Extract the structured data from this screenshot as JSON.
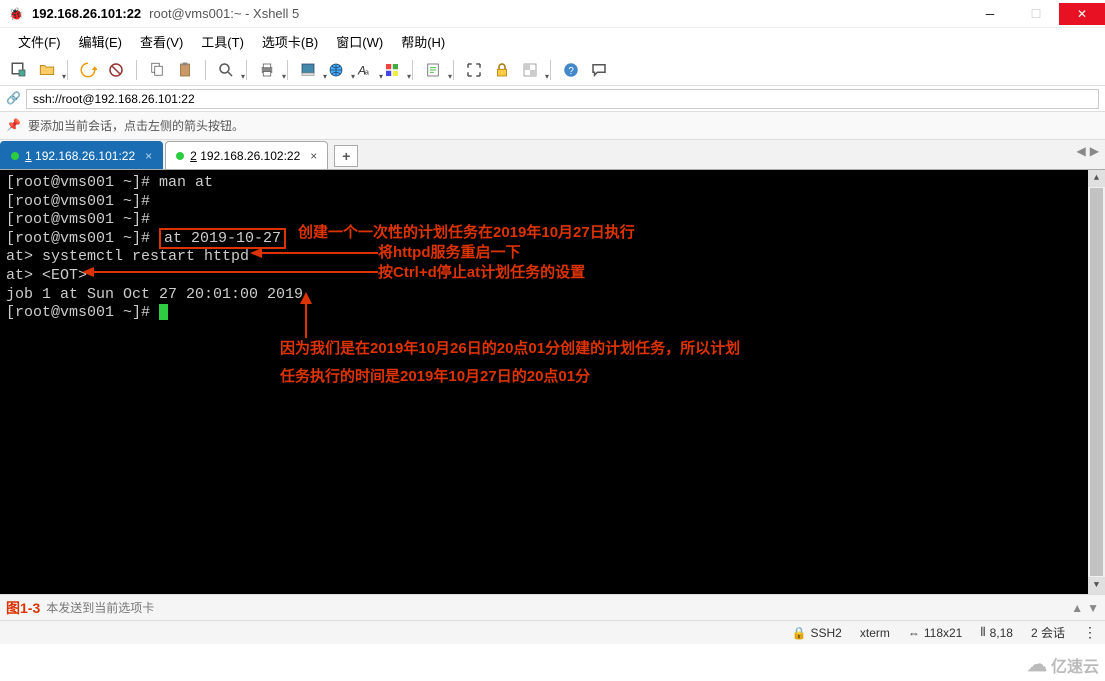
{
  "titlebar": {
    "host": "192.168.26.101:22",
    "subtitle": "root@vms001:~ - Xshell 5"
  },
  "menu": {
    "file": "文件(F)",
    "edit": "编辑(E)",
    "view": "查看(V)",
    "tools": "工具(T)",
    "tabs": "选项卡(B)",
    "window": "窗口(W)",
    "help": "帮助(H)"
  },
  "toolbar": {
    "new_session": "new-session",
    "open": "open",
    "reconnect": "reconnect",
    "disconnect": "disconnect",
    "copy": "copy",
    "paste": "paste",
    "find": "find",
    "print": "print",
    "properties": "properties",
    "globe": "globe",
    "font": "font",
    "color": "color",
    "run_script": "run-script",
    "fullscreen": "fullscreen",
    "lock": "lock",
    "transparent": "transparent",
    "help": "help",
    "feedback": "feedback"
  },
  "address": {
    "url": "ssh://root@192.168.26.101:22"
  },
  "hint": {
    "text": "要添加当前会话，点击左侧的箭头按钮。"
  },
  "tabs": {
    "items": [
      {
        "num": "1",
        "label": "192.168.26.101:22",
        "active": true
      },
      {
        "num": "2",
        "label": "192.168.26.102:22",
        "active": false
      }
    ]
  },
  "terminal": {
    "line1_prompt": "[root@vms001 ~]# ",
    "line1_cmd": "man at",
    "line2": "[root@vms001 ~]#",
    "line3": "[root@vms001 ~]#",
    "line4_prompt": "[root@vms001 ~]# ",
    "line4_boxed": "at 2019-10-27",
    "line5_prompt": "at> ",
    "line5_cmd": "systemctl restart httpd",
    "line6_prompt": "at> ",
    "line6_cmd": "<EOT>",
    "line7": "job 1 at Sun Oct 27 20:01:00 2019",
    "line8": "[root@vms001 ~]# "
  },
  "annotations": {
    "a1": "创建一个一次性的计划任务在2019年10月27日执行",
    "a2": "将httpd服务重启一下",
    "a3": "按Ctrl+d停止at计划任务的设置",
    "a4": "因为我们是在2019年10月26日的20点01分创建的计划任务，所以计划",
    "a5": "任务执行的时间是2019年10月27日的20点01分",
    "fig": "图1-3"
  },
  "sendbar": {
    "text": "本发送到当前选项卡"
  },
  "status": {
    "proto": "SSH2",
    "term": "xterm",
    "size": "118x21",
    "pos": "8,18",
    "sessions": "2 会话"
  },
  "watermark": {
    "text": "亿速云"
  }
}
